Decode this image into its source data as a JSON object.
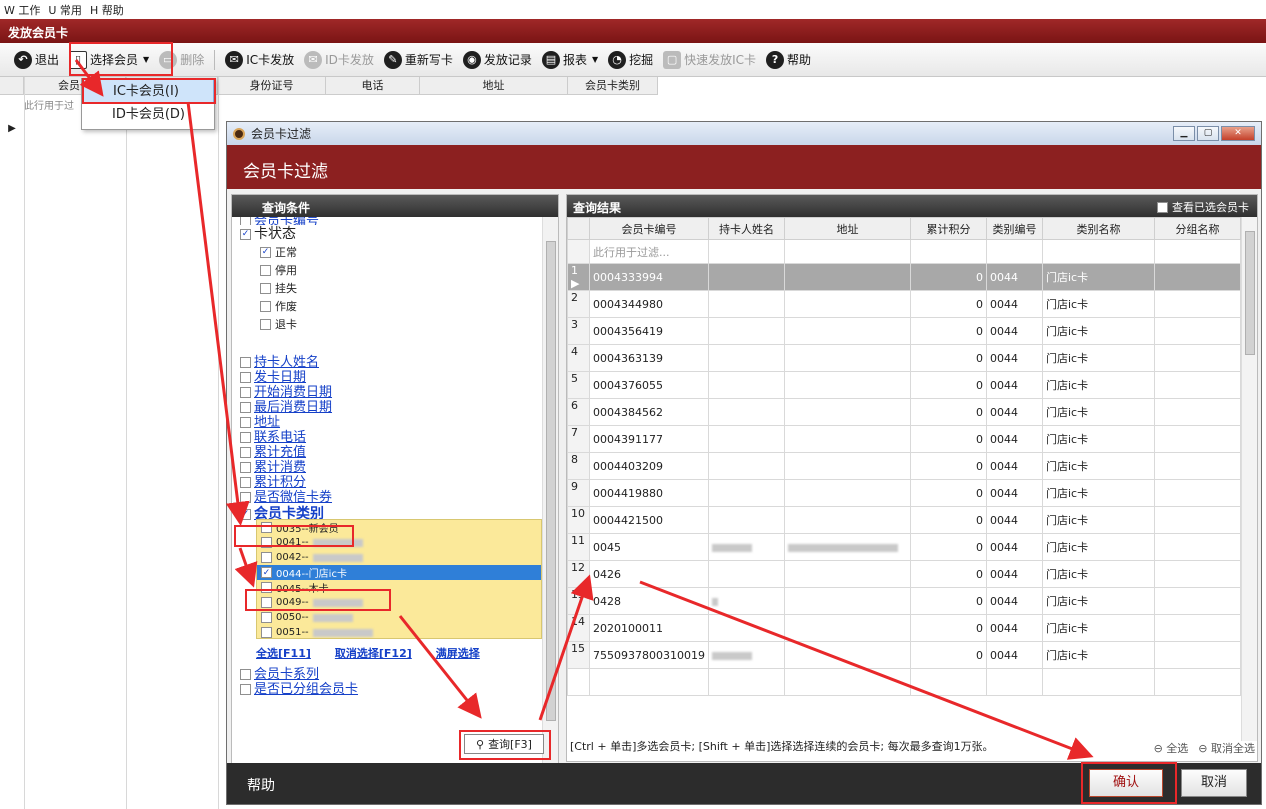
{
  "menu": {
    "items": [
      "W 工作",
      "U 常用",
      "H 帮助"
    ]
  },
  "window_title": "发放会员卡",
  "toolbar": {
    "exit": "退出",
    "select_member": "选择会员",
    "delete": "删除",
    "ic_issue": "IC卡发放",
    "id_issue": "ID卡发放",
    "rewrite": "重新写卡",
    "issue_records": "发放记录",
    "report": "报表",
    "mine": "挖掘",
    "quick_ic": "快速发放IC卡",
    "help": "帮助"
  },
  "dropdown": {
    "items": [
      "IC卡会员(I)",
      "ID卡会员(D)"
    ]
  },
  "bg_grid": {
    "columns": [
      "会员卡",
      "身份证号",
      "电话",
      "地址",
      "会员卡类别"
    ],
    "filter_hint": "此行用于过"
  },
  "dialog": {
    "caption": "会员卡过滤",
    "banner": "会员卡过滤",
    "left_title": "查询条件",
    "criteria_top": [
      "会员卡编号",
      "卡状态"
    ],
    "status_options": [
      {
        "label": "正常",
        "checked": true
      },
      {
        "label": "停用",
        "checked": false
      },
      {
        "label": "挂失",
        "checked": false
      },
      {
        "label": "作废",
        "checked": false
      },
      {
        "label": "退卡",
        "checked": false
      }
    ],
    "criteria_links": [
      "持卡人姓名",
      "发卡日期",
      "开始消费日期",
      "最后消费日期",
      "地址",
      "联系电话",
      "累计充值",
      "累计消费",
      "累计积分",
      "是否微信卡券"
    ],
    "card_type_label": "会员卡类别",
    "card_types": [
      {
        "label": "0035--新会员",
        "checked": false,
        "selected": false
      },
      {
        "label": "0041--",
        "checked": false,
        "selected": false
      },
      {
        "label": "0042--",
        "checked": false,
        "selected": false
      },
      {
        "label": "0044--门店ic卡",
        "checked": true,
        "selected": true
      },
      {
        "label": "0045--木卡",
        "checked": false,
        "selected": false
      },
      {
        "label": "0049--",
        "checked": false,
        "selected": false
      },
      {
        "label": "0050--",
        "checked": false,
        "selected": false
      },
      {
        "label": "0051--",
        "checked": false,
        "selected": false
      }
    ],
    "select_all": "全选[F11]",
    "deselect": "取消选择[F12]",
    "fullscreen_select": "满屏选择",
    "criteria_bottom": [
      "会员卡系列",
      "是否已分组会员卡"
    ],
    "query_button": "查询[F3]",
    "right_title": "查询结果",
    "view_selected": "查看已选会员卡",
    "columns": [
      "会员卡编号",
      "持卡人姓名",
      "地址",
      "累计积分",
      "类别编号",
      "类别名称",
      "分组名称"
    ],
    "filter_hint": "此行用于过滤...",
    "rows": [
      {
        "no": "1",
        "card": "0004333994",
        "points": "0",
        "type_no": "0044",
        "type_name": "门店ic卡"
      },
      {
        "no": "2",
        "card": "0004344980",
        "points": "0",
        "type_no": "0044",
        "type_name": "门店ic卡"
      },
      {
        "no": "3",
        "card": "0004356419",
        "points": "0",
        "type_no": "0044",
        "type_name": "门店ic卡"
      },
      {
        "no": "4",
        "card": "0004363139",
        "points": "0",
        "type_no": "0044",
        "type_name": "门店ic卡"
      },
      {
        "no": "5",
        "card": "0004376055",
        "points": "0",
        "type_no": "0044",
        "type_name": "门店ic卡"
      },
      {
        "no": "6",
        "card": "0004384562",
        "points": "0",
        "type_no": "0044",
        "type_name": "门店ic卡"
      },
      {
        "no": "7",
        "card": "0004391177",
        "points": "0",
        "type_no": "0044",
        "type_name": "门店ic卡"
      },
      {
        "no": "8",
        "card": "0004403209",
        "points": "0",
        "type_no": "0044",
        "type_name": "门店ic卡"
      },
      {
        "no": "9",
        "card": "0004419880",
        "points": "0",
        "type_no": "0044",
        "type_name": "门店ic卡"
      },
      {
        "no": "10",
        "card": "0004421500",
        "points": "0",
        "type_no": "0044",
        "type_name": "门店ic卡"
      },
      {
        "no": "11",
        "card": "0045",
        "points": "0",
        "type_no": "0044",
        "type_name": "门店ic卡"
      },
      {
        "no": "12",
        "card": "0426",
        "points": "0",
        "type_no": "0044",
        "type_name": "门店ic卡"
      },
      {
        "no": "13",
        "card": "0428",
        "points": "0",
        "type_no": "0044",
        "type_name": "门店ic卡"
      },
      {
        "no": "14",
        "card": "2020100011",
        "points": "0",
        "type_no": "0044",
        "type_name": "门店ic卡"
      },
      {
        "no": "15",
        "card": "7550937800310019",
        "points": "0",
        "type_no": "0044",
        "type_name": "门店ic卡"
      }
    ],
    "hint": "[Ctrl + 单击]多选会员卡; [Shift + 单击]选择选择连续的会员卡; 每次最多查询1万张。",
    "select_all_results": "全选",
    "cancel_all": "取消全选",
    "help": "帮助",
    "ok": "确认",
    "cancel": "取消"
  }
}
